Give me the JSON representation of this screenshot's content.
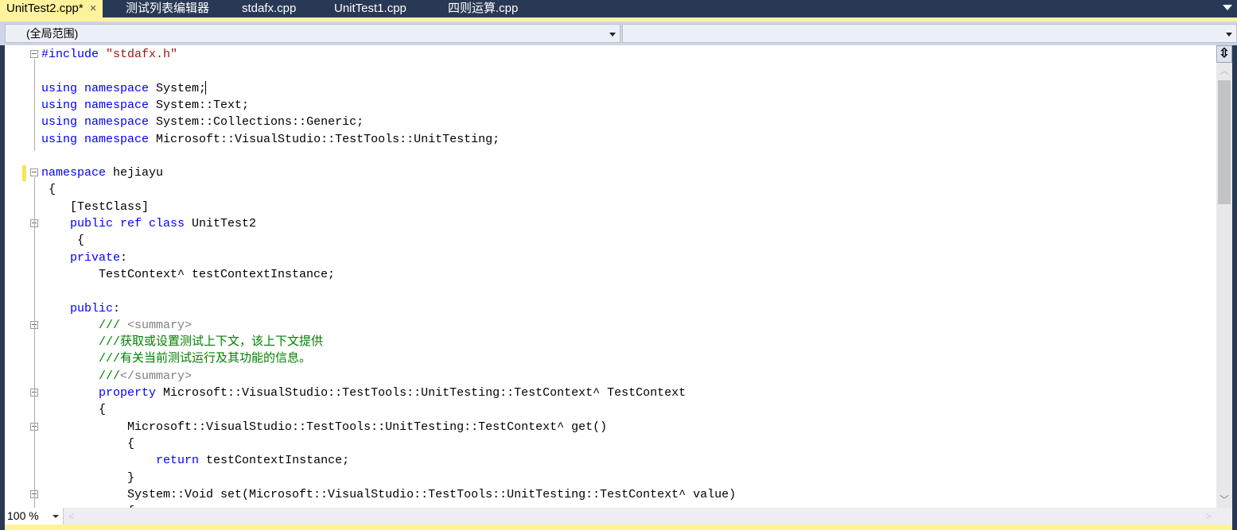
{
  "tabs": [
    {
      "label": "UnitTest2.cpp*",
      "active": true,
      "close": "×"
    },
    {
      "label": "测试列表编辑器"
    },
    {
      "label": "stdafx.cpp"
    },
    {
      "label": "UnitTest1.cpp"
    },
    {
      "label": "四则运算.cpp"
    }
  ],
  "navbar": {
    "scope": "(全局范围)",
    "member": ""
  },
  "zoom_level": "100 %",
  "colors": {
    "keyword": "#0000ff",
    "string": "#a31515",
    "comment": "#008000",
    "tab_active": "#fff29d",
    "chrome": "#293955"
  },
  "code_lines": [
    [
      [
        "#include ",
        "kw"
      ],
      [
        "\"stdafx.h\"",
        "str"
      ]
    ],
    [],
    [
      [
        "using namespace",
        "kw"
      ],
      [
        " System;",
        ""
      ]
    ],
    [
      [
        "using namespace",
        "kw"
      ],
      [
        " System::Text;",
        ""
      ]
    ],
    [
      [
        "using namespace",
        "kw"
      ],
      [
        " System::Collections::Generic;",
        ""
      ]
    ],
    [
      [
        "using namespace",
        "kw"
      ],
      [
        " Microsoft::VisualStudio::TestTools::UnitTesting;",
        ""
      ]
    ],
    [],
    [
      [
        "namespace",
        "kw"
      ],
      [
        " hejiayu",
        ""
      ]
    ],
    [
      [
        " {",
        ""
      ]
    ],
    [
      [
        "    [TestClass]",
        ""
      ]
    ],
    [
      [
        "    ",
        ""
      ],
      [
        "public ref class",
        "kw"
      ],
      [
        " UnitTest2",
        ""
      ]
    ],
    [
      [
        "     {",
        ""
      ]
    ],
    [
      [
        "    ",
        ""
      ],
      [
        "private",
        "kw"
      ],
      [
        ":",
        ""
      ]
    ],
    [
      [
        "        TestContext^ testContextInstance;",
        ""
      ]
    ],
    [],
    [
      [
        "    ",
        ""
      ],
      [
        "public",
        "kw"
      ],
      [
        ":",
        ""
      ]
    ],
    [
      [
        "        ",
        ""
      ],
      [
        "///",
        "cm"
      ],
      [
        " <summary>",
        "doc"
      ]
    ],
    [
      [
        "        ",
        ""
      ],
      [
        "///获取或设置测试上下文，该上下文提供",
        "cm"
      ]
    ],
    [
      [
        "        ",
        ""
      ],
      [
        "///有关当前测试运行及其功能的信息。",
        "cm"
      ]
    ],
    [
      [
        "        ",
        ""
      ],
      [
        "///",
        "cm"
      ],
      [
        "</summary>",
        "doc"
      ]
    ],
    [
      [
        "        ",
        ""
      ],
      [
        "property",
        "kw"
      ],
      [
        " Microsoft::VisualStudio::TestTools::UnitTesting::TestContext^ TestContext",
        ""
      ]
    ],
    [
      [
        "        {",
        ""
      ]
    ],
    [
      [
        "            Microsoft::VisualStudio::TestTools::UnitTesting::TestContext^ get()",
        ""
      ]
    ],
    [
      [
        "            {",
        ""
      ]
    ],
    [
      [
        "                ",
        ""
      ],
      [
        "return",
        "kw"
      ],
      [
        " testContextInstance;",
        ""
      ]
    ],
    [
      [
        "            }",
        ""
      ]
    ],
    [
      [
        "            System::Void set(Microsoft::VisualStudio::TestTools::UnitTesting::TestContext^ value)",
        ""
      ]
    ],
    [
      [
        "            {",
        ""
      ]
    ]
  ]
}
